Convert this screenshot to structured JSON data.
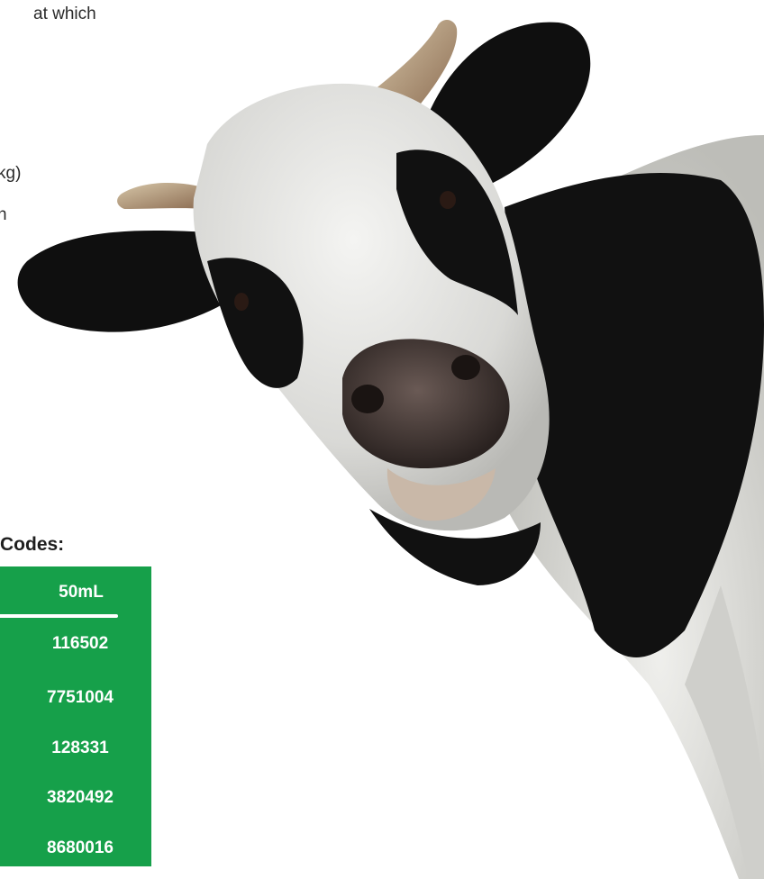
{
  "text_fragments": {
    "line_1": "at which",
    "line_2": "kg)",
    "line_3": "n"
  },
  "codes": {
    "heading": "Codes:",
    "column_header": "50mL",
    "rows": [
      "116502",
      "7751004",
      "128331",
      "3820492",
      "8680016"
    ]
  },
  "colors": {
    "table_green": "#16a04a",
    "text": "#2b2b2b"
  },
  "image": {
    "subject": "black-and-white cow peeking in from the right"
  }
}
